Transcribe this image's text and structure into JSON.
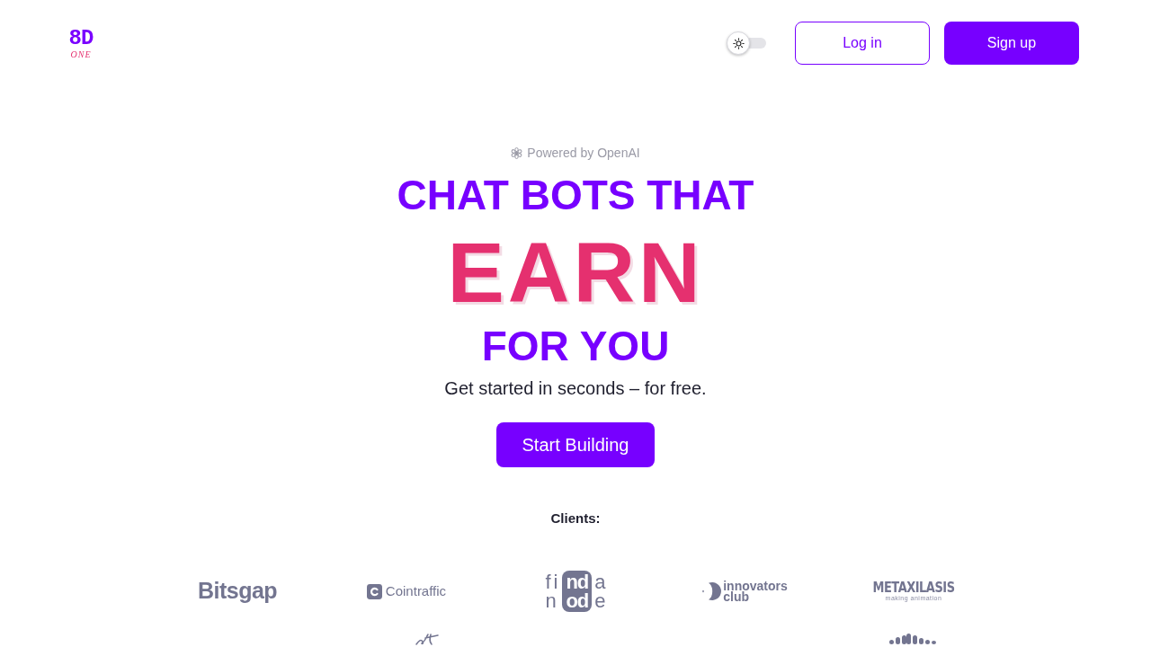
{
  "header": {
    "logo": {
      "mark": "8D",
      "script": "ONE"
    },
    "theme_toggle": {
      "on": false
    },
    "buttons": [
      {
        "label": "Log in",
        "kind": "outline"
      },
      {
        "label": "Sign up",
        "kind": "solid"
      }
    ]
  },
  "hero": {
    "badge": "Powered by OpenAI",
    "headline": [
      {
        "text": "CHAT BOTS THAT",
        "kind": "plain"
      },
      {
        "text": "EARN",
        "kind": "accent"
      },
      {
        "text": "FOR YOU",
        "kind": "plain"
      }
    ],
    "subtitle": "Get started in seconds – for free.",
    "cta": "Start Building"
  },
  "clients": {
    "title": "Clients:",
    "logos": [
      {
        "kind": "wordmark",
        "text": "Bitsgap"
      },
      {
        "kind": "icon-wordmark",
        "text": "Cointraffic"
      },
      {
        "kind": "split",
        "rows": [
          [
            "fi",
            "nd",
            "a"
          ],
          [
            "n",
            "od",
            "e"
          ]
        ]
      },
      {
        "kind": "moon",
        "lines": [
          "innovators",
          "club"
        ]
      },
      {
        "kind": "display",
        "text": "METAXILASIS",
        "tagline": "making animation"
      }
    ],
    "more_logos": [
      {
        "kind": "script"
      },
      {
        "kind": "bars"
      }
    ]
  }
}
